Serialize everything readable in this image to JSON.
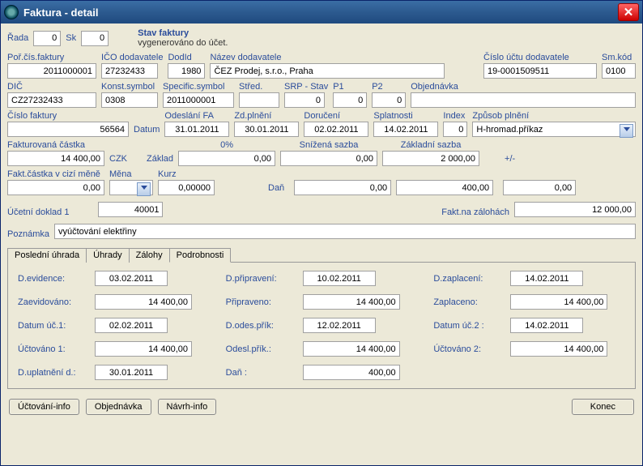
{
  "window": {
    "title": "Faktura - detail"
  },
  "top": {
    "rada_label": "Řada",
    "rada": "0",
    "sk_label": "Sk",
    "sk": "0",
    "status_hdr": "Stav faktury",
    "status_text": "vygenerováno do účet."
  },
  "r1": {
    "porcis_l": "Poř.čís.faktury",
    "porcis": "2011000001",
    "ico_l": "IČO dodavatele",
    "ico": "27232433",
    "dodid_l": "DodId",
    "dodid": "1980",
    "nazev_l": "Název dodavatele",
    "nazev": "ČEZ Prodej, s.r.o., Praha",
    "cislouctu_l": "Číslo účtu dodavatele",
    "cislouctu": "19-0001509511",
    "smkod_l": "Sm.kód",
    "smkod": "0100"
  },
  "r2": {
    "dic_l": "DIČ",
    "dic": "CZ27232433",
    "ks_l": "Konst.symbol",
    "ks": "0308",
    "ss_l": "Specific.symbol",
    "ss": "2011000001",
    "stred_l": "Střed.",
    "stred": "",
    "srp_l": "SRP - Stav",
    "srp": "0",
    "p1_l": "P1",
    "p1": "0",
    "p2_l": "P2",
    "p2": "0",
    "obj_l": "Objednávka",
    "obj": ""
  },
  "r3": {
    "cf_l": "Číslo faktury",
    "cf": "56564",
    "datum_l": "Datum",
    "odes_l": "Odeslání FA",
    "odes": "31.01.2011",
    "zdpl_l": "Zd.plnění",
    "zdpl": "30.01.2011",
    "doruc_l": "Doručení",
    "doruc": "02.02.2011",
    "splat_l": "Splatnosti",
    "splat": "14.02.2011",
    "index_l": "Index",
    "index": "0",
    "zpln_l": "Způsob plnění",
    "zpln": "H-hromad.příkaz"
  },
  "r4": {
    "fakt_l": "Fakturovaná částka",
    "fakt": "14 400,00",
    "czk": "CZK",
    "zaklad_l": "Základ",
    "pct": "0%",
    "zaklad": "0,00",
    "sniz_l": "Snížená sazba",
    "sniz": "0,00",
    "zakls_l": "Základní sazba",
    "zakls": "2 000,00",
    "pm": "+/-"
  },
  "r5": {
    "fcm_l": "Fakt.částka v cizí měně",
    "fcm": "0,00",
    "mena_l": "Měna",
    "mena": "",
    "kurz_l": "Kurz",
    "kurz": "0,00000",
    "dan_l": "Daň",
    "sniz_dan": "0,00",
    "zakl_dan": "400,00",
    "pm_dan": "0,00"
  },
  "r6": {
    "ud_l": "Účetní doklad 1",
    "ud": "40001",
    "fz_l": "Fakt.na zálohách",
    "fz": "12 000,00"
  },
  "r7": {
    "pozn_l": "Poznámka",
    "pozn": "vyúčtování elektřiny"
  },
  "tabs": {
    "t0": "Poslední úhrada",
    "t1": "Úhrady",
    "t2": "Zálohy",
    "t3": "Podrobnosti"
  },
  "detail": {
    "dev_l": "D.evidence:",
    "dev": "03.02.2011",
    "zaev_l": "Zaevidováno:",
    "zaev": "14 400,00",
    "duc1_l": "Datum úč.1:",
    "duc1": "02.02.2011",
    "uc1_l": "Účtováno 1:",
    "uc1": "14 400,00",
    "dup_l": "D.uplatnění d.:",
    "dup": "30.01.2011",
    "dprip_l": "D.připravení:",
    "dprip": "10.02.2011",
    "prip_l": "Připraveno:",
    "prip": "14 400,00",
    "dodp_l": "D.odes.přík:",
    "dodp": "12.02.2011",
    "odp_l": "Odesl.přík.:",
    "odp": "14 400,00",
    "dan_l": "Daň :",
    "dan": "400,00",
    "dzap_l": "D.zaplacení:",
    "dzap": "14.02.2011",
    "zap_l": "Zaplaceno:",
    "zap": "14 400,00",
    "duc2_l": "Datum úč.2 :",
    "duc2": "14.02.2011",
    "uc2_l": "Účtováno 2:",
    "uc2": "14 400,00"
  },
  "buttons": {
    "b0": "Účtování-info",
    "b1": "Objednávka",
    "b2": "Návrh-info",
    "konec": "Konec"
  }
}
